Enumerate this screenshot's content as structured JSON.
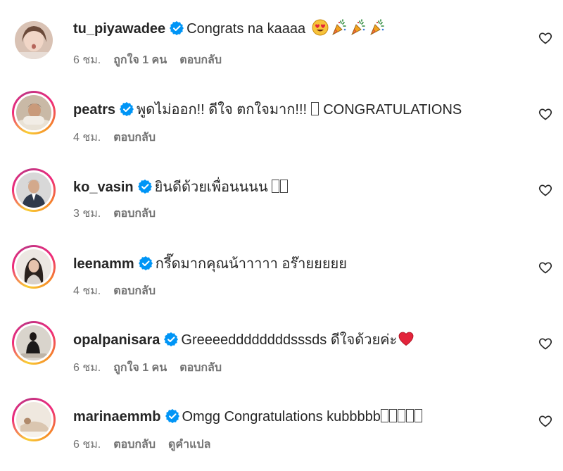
{
  "comments": [
    {
      "username": "tu_piyawadee",
      "text": "Congrats na kaaaa",
      "time": "6 ชม.",
      "likes": "ถูกใจ 1 คน",
      "reply": "ตอบกลับ",
      "emojis": [
        "heart-eyes-icon",
        "party-popper-icon",
        "party-popper-icon",
        "party-popper-icon"
      ]
    },
    {
      "username": "peatrs",
      "text": "พูดไม่ออก!! ดีใจ ตกใจมาก!!!",
      "text_after": "CONGRATULATIONS",
      "time": "4 ชม.",
      "reply": "ตอบกลับ"
    },
    {
      "username": "ko_vasin",
      "text": "ยินดีด้วยเพื่อนนนน",
      "time": "3 ชม.",
      "reply": "ตอบกลับ"
    },
    {
      "username": "leenamm",
      "text": "กรี๊ดมากคุณน้าาาาา อร๊ายยยยย",
      "time": "4 ชม.",
      "reply": "ตอบกลับ"
    },
    {
      "username": "opalpanisara",
      "text": "Greeeeddddddddsssds ดีใจด้วยค่ะ",
      "time": "6 ชม.",
      "likes": "ถูกใจ 1 คน",
      "reply": "ตอบกลับ",
      "emojis": [
        "red-heart-icon"
      ]
    },
    {
      "username": "marinaemmb",
      "text": "Omgg Congratulations kubbbbb",
      "time": "6 ชม.",
      "reply": "ตอบกลับ",
      "translate": "ดูคำแปล"
    }
  ],
  "colors": {
    "verified": "#0095f6",
    "meta_text": "#737373",
    "text": "#262626"
  }
}
